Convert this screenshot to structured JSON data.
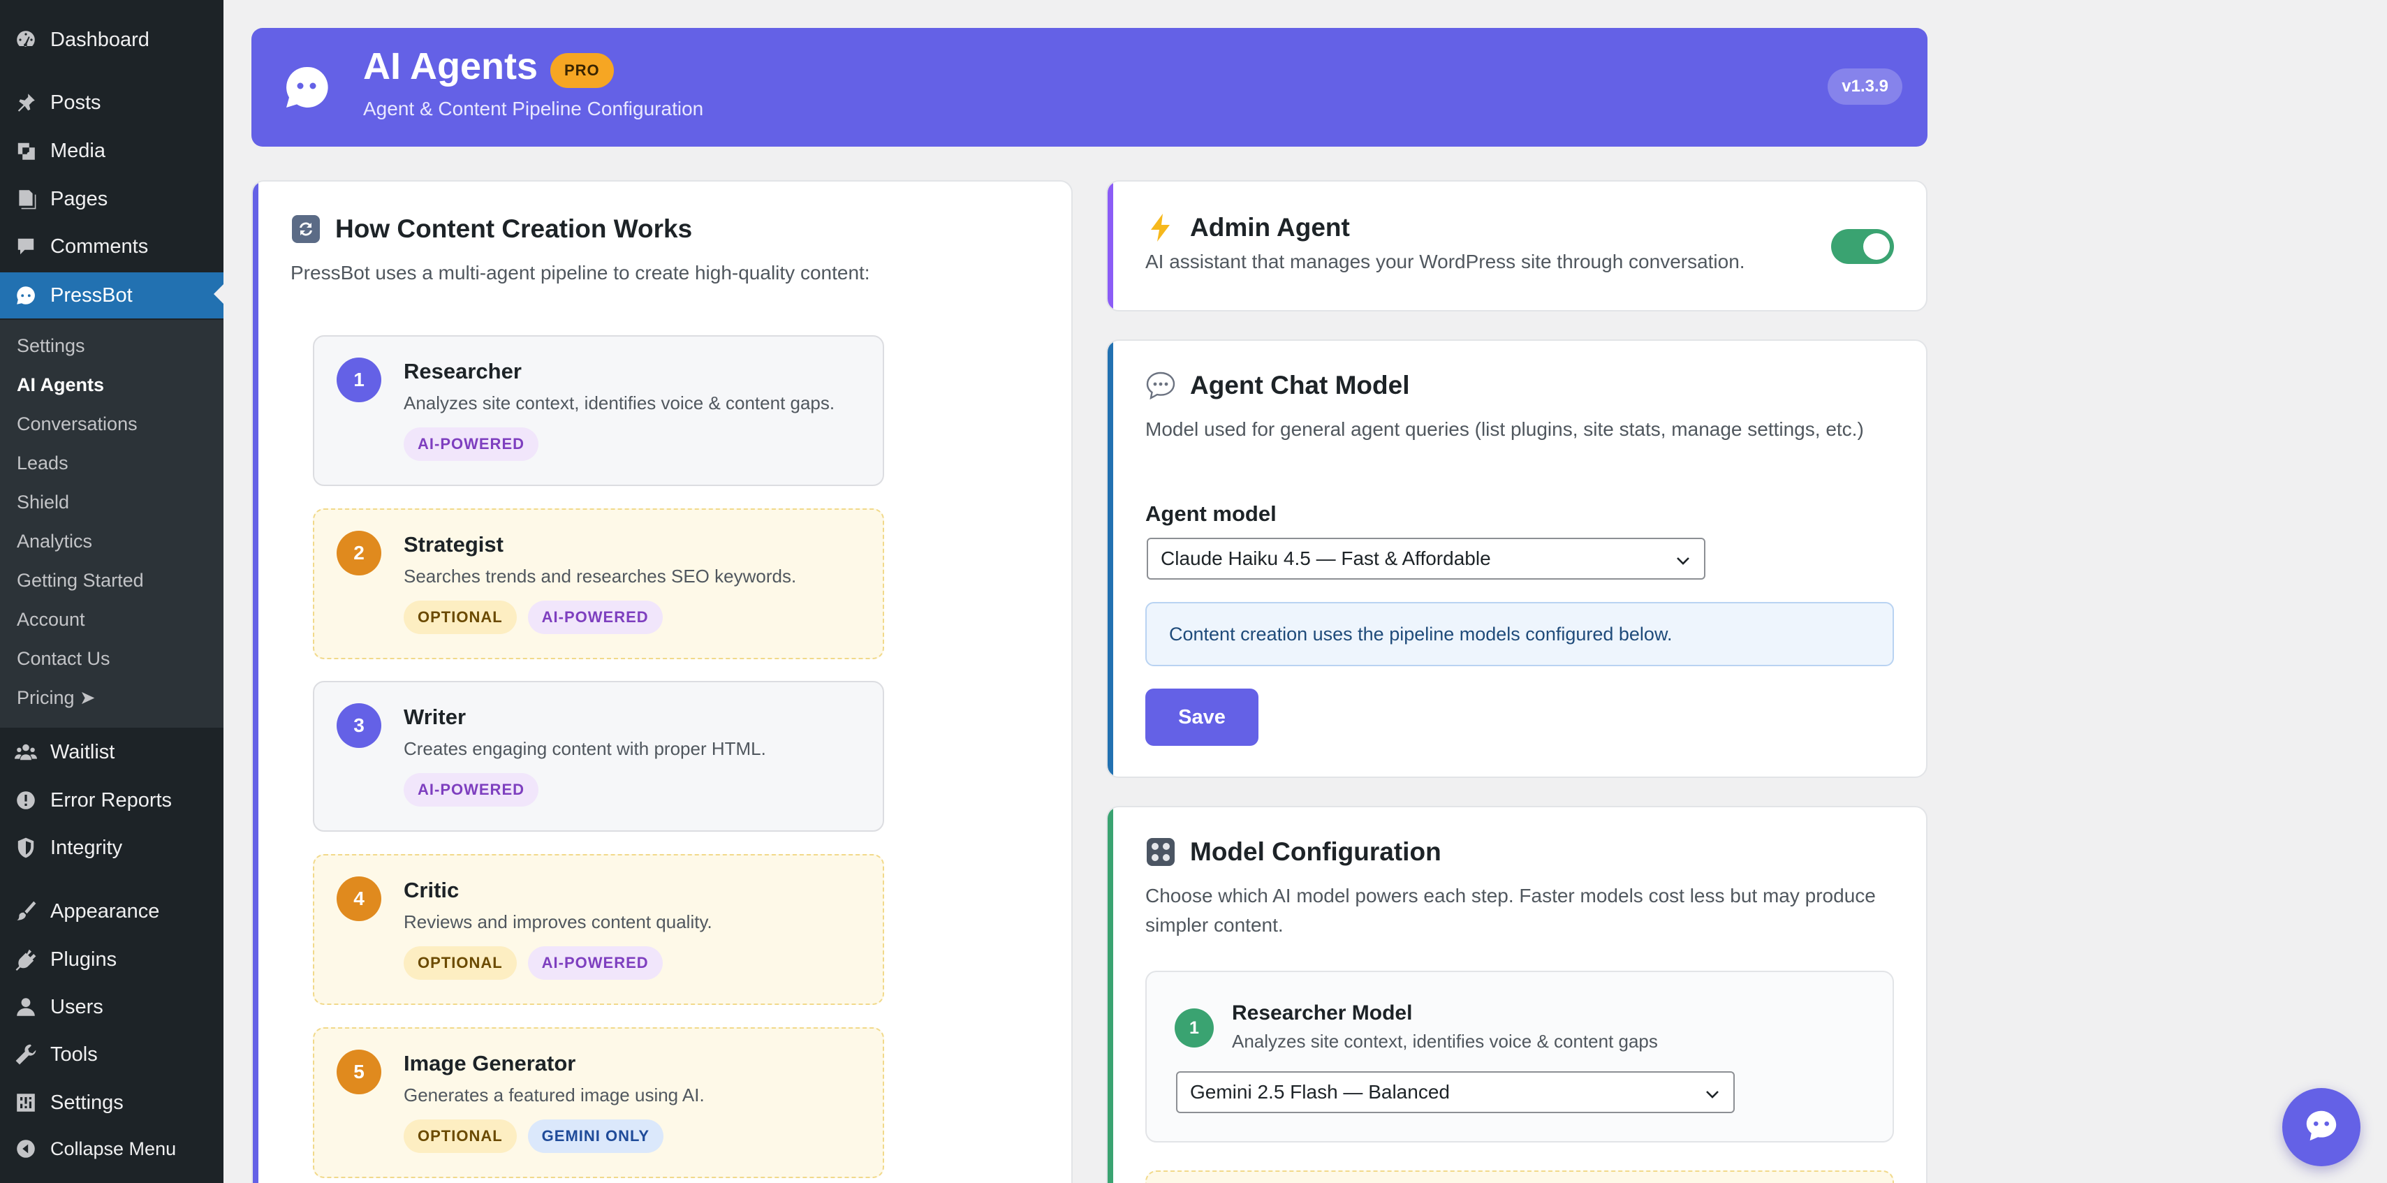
{
  "sidebar": {
    "items": [
      {
        "label": "Dashboard",
        "icon": "dashboard-icon"
      },
      {
        "label": "Posts",
        "icon": "pin-icon"
      },
      {
        "label": "Media",
        "icon": "media-icon"
      },
      {
        "label": "Pages",
        "icon": "pages-icon"
      },
      {
        "label": "Comments",
        "icon": "comment-icon"
      },
      {
        "label": "PressBot",
        "icon": "pressbot-icon"
      },
      {
        "label": "Waitlist",
        "icon": "groups-icon"
      },
      {
        "label": "Error Reports",
        "icon": "warning-icon"
      },
      {
        "label": "Integrity",
        "icon": "shield-icon"
      },
      {
        "label": "Appearance",
        "icon": "brush-icon"
      },
      {
        "label": "Plugins",
        "icon": "plugin-icon"
      },
      {
        "label": "Users",
        "icon": "user-icon"
      },
      {
        "label": "Tools",
        "icon": "wrench-icon"
      },
      {
        "label": "Settings",
        "icon": "sliders-icon"
      },
      {
        "label": "Collapse Menu",
        "icon": "collapse-icon"
      }
    ],
    "submenu": [
      "Settings",
      "AI Agents",
      "Conversations",
      "Leads",
      "Shield",
      "Analytics",
      "Getting Started",
      "Account",
      "Contact Us",
      "Pricing ➤"
    ]
  },
  "header": {
    "title": "AI Agents",
    "badge": "PRO",
    "subtitle": "Agent & Content Pipeline Configuration",
    "version": "v1.3.9"
  },
  "pipeline": {
    "title": "How Content Creation Works",
    "desc": "PressBot uses a multi-agent pipeline to create high-quality content:",
    "steps": [
      {
        "num": "1",
        "name": "Researcher",
        "desc": "Analyzes site context, identifies voice & content gaps.",
        "tags": [
          "AI-POWERED"
        ],
        "color": "#6461e6"
      },
      {
        "num": "2",
        "name": "Strategist",
        "desc": "Searches trends and researches SEO keywords.",
        "tags": [
          "OPTIONAL",
          "AI-POWERED"
        ],
        "color": "#e08a1e"
      },
      {
        "num": "3",
        "name": "Writer",
        "desc": "Creates engaging content with proper HTML.",
        "tags": [
          "AI-POWERED"
        ],
        "color": "#6461e6"
      },
      {
        "num": "4",
        "name": "Critic",
        "desc": "Reviews and improves content quality.",
        "tags": [
          "OPTIONAL",
          "AI-POWERED"
        ],
        "color": "#e08a1e"
      },
      {
        "num": "5",
        "name": "Image Generator",
        "desc": "Generates a featured image using AI.",
        "tags": [
          "OPTIONAL",
          "GEMINI ONLY"
        ],
        "color": "#e08a1e"
      }
    ]
  },
  "admin_agent": {
    "title": "Admin Agent",
    "desc": "AI assistant that manages your WordPress site through conversation.",
    "enabled": true
  },
  "chat_model": {
    "title": "Agent Chat Model",
    "desc": "Model used for general agent queries (list plugins, site stats, manage settings, etc.)",
    "field_label": "Agent model",
    "selected": "Claude Haiku 4.5 — Fast & Affordable",
    "info": "Content creation uses the pipeline models configured below.",
    "save_label": "Save"
  },
  "model_config": {
    "title": "Model Configuration",
    "desc": "Choose which AI model powers each step. Faster models cost less but may produce simpler content.",
    "researcher": {
      "num": "1",
      "name": "Researcher Model",
      "desc": "Analyzes site context, identifies voice & content gaps",
      "selected": "Gemini 2.5 Flash — Balanced"
    }
  },
  "colors": {
    "accent": "#6461e6",
    "wp_blue": "#2271b1",
    "success": "#3aa371",
    "warning": "#e08a1e"
  }
}
